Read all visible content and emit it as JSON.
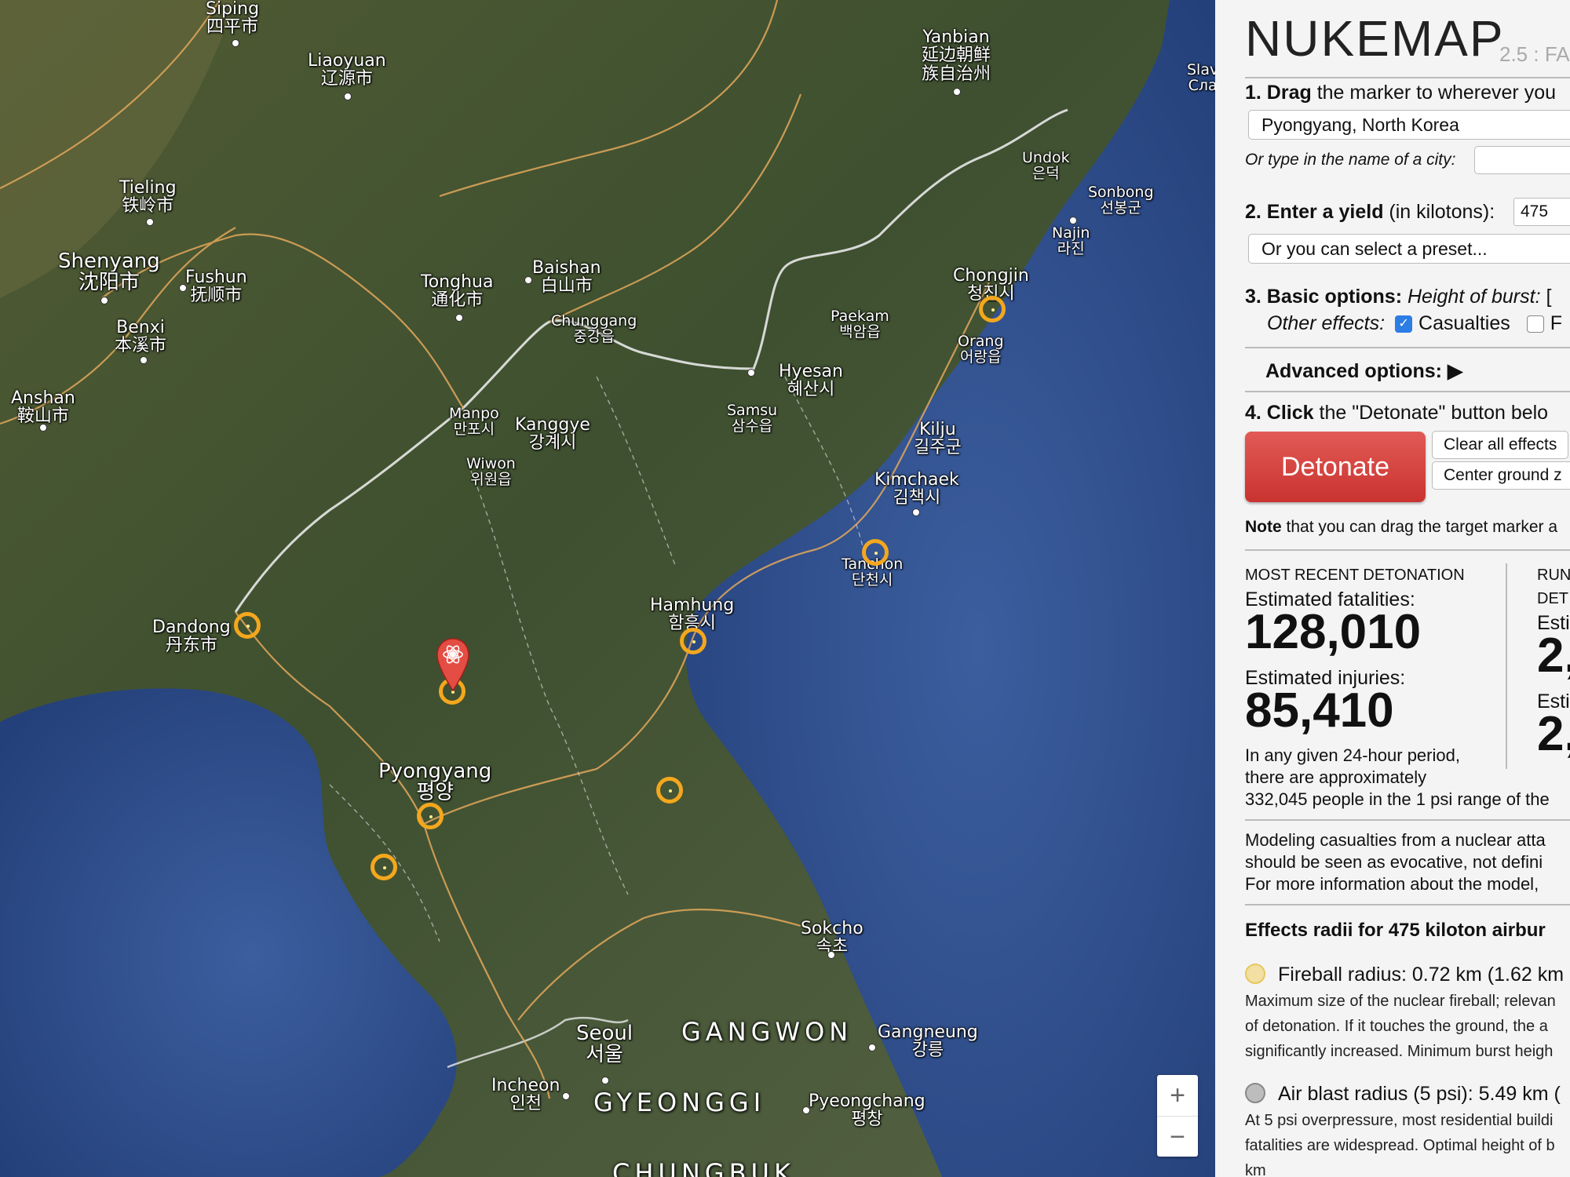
{
  "map": {
    "labels": [
      {
        "en": "Siping",
        "loc": "四平市"
      },
      {
        "en": "Liaoyuan",
        "loc": "辽源市"
      },
      {
        "en": "Yanbian",
        "loc": "延边朝鲜族自治州"
      },
      {
        "en": "Tieling",
        "loc": "铁岭市"
      },
      {
        "en": "Shenyang",
        "loc": "沈阳市"
      },
      {
        "en": "Fushun",
        "loc": "抚顺市"
      },
      {
        "en": "Benxi",
        "loc": "本溪市"
      },
      {
        "en": "Anshan",
        "loc": "鞍山市"
      },
      {
        "en": "Tonghua",
        "loc": "通化市"
      },
      {
        "en": "Baishan",
        "loc": "白山市"
      },
      {
        "en": "Chunggang",
        "loc": "중강읍"
      },
      {
        "en": "Undok",
        "loc": "은덕"
      },
      {
        "en": "Sonbong",
        "loc": "선봉군"
      },
      {
        "en": "Najin",
        "loc": "라진"
      },
      {
        "en": "Chongjin",
        "loc": "청진시"
      },
      {
        "en": "Paekam",
        "loc": "백암읍"
      },
      {
        "en": "Orang",
        "loc": "어랑읍"
      },
      {
        "en": "Hyesan",
        "loc": "혜산시"
      },
      {
        "en": "Samsu",
        "loc": "삼수읍"
      },
      {
        "en": "Manpo",
        "loc": "만포시"
      },
      {
        "en": "Kanggye",
        "loc": "강계시"
      },
      {
        "en": "Wiwon",
        "loc": "위원읍"
      },
      {
        "en": "Kilju",
        "loc": "길주군"
      },
      {
        "en": "Kimchaek",
        "loc": "김책시"
      },
      {
        "en": "Tanchon",
        "loc": "단천시"
      },
      {
        "en": "Dandong",
        "loc": "丹东市"
      },
      {
        "en": "Hamhung",
        "loc": "함흥시"
      },
      {
        "en": "Pyongyang",
        "loc": "평양"
      },
      {
        "en": "Sokcho",
        "loc": "속초"
      },
      {
        "en": "Seoul",
        "loc": "서울"
      },
      {
        "en": "Gangneung",
        "loc": "강릉"
      },
      {
        "en": "Incheon",
        "loc": "인천"
      },
      {
        "en": "Pyeongchang",
        "loc": "평창"
      },
      {
        "en": "Slav",
        "loc": "Сла"
      }
    ],
    "regions": [
      "GANGWON",
      "GYEONGGI",
      "CHUNGBUK"
    ],
    "zoom_in": "+",
    "zoom_out": "−"
  },
  "panel": {
    "logo": "NUKEMAP",
    "version": "2.5 : FA",
    "step1_bold": "1. Drag",
    "step1_rest": " the marker to wherever you",
    "location_value": "Pyongyang, North Korea",
    "city_prompt": "Or type in the name of a city:",
    "step2_bold": "2. Enter a yield",
    "step2_rest": " (in kilotons):",
    "yield_value": "475",
    "preset_placeholder": "Or you can select a preset...",
    "step3_bold": "3. Basic options:",
    "step3_italic": " Height of burst:",
    "step3_extra": " [",
    "other_effects": "Other effects:",
    "casualties_label": "Casualties",
    "fallout_label": "F",
    "advanced": "Advanced options: ▶",
    "step4_bold": "4. Click",
    "step4_rest": " the \"Detonate\" button belo",
    "detonate": "Detonate",
    "clear_effects": "Clear all effects",
    "center_ground": "Center ground z",
    "note_bold": "Note",
    "note_rest": " that you can drag the target marker a",
    "recent_header": "MOST RECENT DETONATION",
    "run_header_1": "RUN",
    "run_header_2": "DET",
    "fatalities_label": "Estimated fatalities:",
    "fatalities_value": "128,010",
    "injuries_label": "Estimated injuries:",
    "injuries_value": "85,410",
    "run_esti_1": "Esti",
    "run_val_1": "2,",
    "run_esti_2": "Esti",
    "run_val_2": "2,",
    "period_1": "In any given 24-hour period,",
    "period_2": "there are approximately",
    "period_3": "332,045 people in the 1 psi range of the",
    "model_1": "Modeling casualties from a nuclear atta",
    "model_2": "should be seen as evocative, not defini",
    "model_3": "For more information about the model,",
    "effects_header": "Effects radii for 475 kiloton airbur",
    "fireball_label": "Fireball radius: 0.72 km (1.62 km",
    "fireball_desc_1": "Maximum size of the nuclear fireball; relevan",
    "fireball_desc_2": "of detonation. If it touches the ground, the a",
    "fireball_desc_3": "significantly increased. Minimum burst heigh",
    "blast_label": "Air blast radius (5 psi): 5.49 km (",
    "blast_desc_1": "At 5 psi overpressure, most residential buildi",
    "blast_desc_2": "fatalities are widespread. Optimal height of b",
    "blast_desc_3": "km",
    "fireball_color": "#f3dfa2",
    "blast_color": "#bdbdbd",
    "detonate_color": "#d64541",
    "checkbox_color": "#2c7de4"
  }
}
